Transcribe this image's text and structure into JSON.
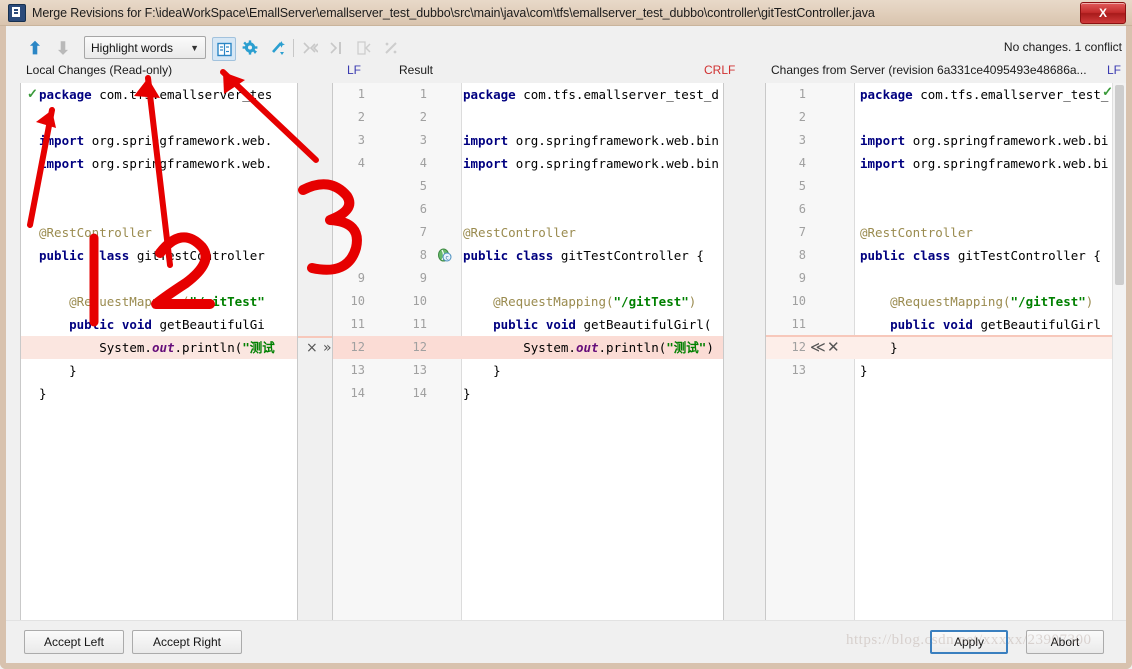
{
  "window": {
    "title": "Merge Revisions for F:\\ideaWorkSpace\\EmallServer\\emallserver_test_dubbo\\src\\main\\java\\com\\tfs\\emallserver_test_dubbo\\controller\\gitTestController.java",
    "close_label": "X",
    "icon": "app-icon"
  },
  "toolbar": {
    "prev_icon": "arrow-up-icon",
    "next_icon": "arrow-down-icon",
    "highlight_mode": "Highlight words",
    "caret": "⌄",
    "icons": [
      "side-by-side-diff-icon",
      "settings-gear-icon",
      "magic-wand-icon",
      "apply-all-left-icon",
      "apply-non-conflicts-icon",
      "apply-left-icon",
      "ignore-icon"
    ],
    "status": "No changes. 1 conflict"
  },
  "panes": {
    "left_title": "Local Changes (Read-only)",
    "left_sep": "LF",
    "result_title": "Result",
    "result_sep": "CRLF",
    "right_title": "Changes from Server (revision 6a331ce4095493e48686a...",
    "right_sep": "LF"
  },
  "left_editor": {
    "lines": [
      "package com.tfs.emallserver_tes",
      "",
      "import org.springframework.web.",
      "import org.springframework.web.",
      "",
      "",
      "@RestController",
      "public class gitTestController",
      "",
      "    @RequestMapping(\"/gitTest\"",
      "    public void getBeautifulGi",
      "        System.out.println(\"测试",
      "    }",
      "}"
    ],
    "check_icon": "green-check-icon"
  },
  "result_editor": {
    "left_numbers": [
      "1",
      "2",
      "3",
      "4",
      "",
      "",
      "",
      "",
      "9",
      "10",
      "11",
      "12",
      "13",
      "14"
    ],
    "right_numbers": [
      "1",
      "2",
      "3",
      "4",
      "5",
      "6",
      "7",
      "8",
      "9",
      "10",
      "11",
      "12",
      "13",
      "14"
    ],
    "lines": [
      "package com.tfs.emallserver_test_d",
      "",
      "import org.springframework.web.bin",
      "import org.springframework.web.bin",
      "",
      "",
      "@RestController",
      "public class gitTestController {",
      "",
      "    @RequestMapping(\"/gitTest\")",
      "    public void getBeautifulGirl(",
      "        System.out.println(\"测试\")",
      "    }",
      "}"
    ],
    "class_icon": "java-class-icon",
    "conflict_row": 12,
    "conflict_actions": [
      "×",
      "»"
    ]
  },
  "right_editor": {
    "numbers": [
      "1",
      "2",
      "3",
      "4",
      "5",
      "6",
      "7",
      "8",
      "9",
      "10",
      "11",
      "12",
      "13"
    ],
    "lines": [
      "package com.tfs.emallserver_test_",
      "",
      "import org.springframework.web.bi",
      "import org.springframework.web.bi",
      "",
      "",
      "@RestController",
      "public class gitTestController {",
      "",
      "    @RequestMapping(\"/gitTest\")",
      "    public void getBeautifulGirl",
      "    }",
      "}"
    ],
    "conflict_row": 12,
    "conflict_actions": [
      "≪",
      "✕"
    ],
    "check_icon": "green-check-icon"
  },
  "buttons": {
    "accept_left": "Accept Left",
    "accept_right": "Accept Right",
    "apply": "Apply",
    "abort": "Abort"
  },
  "annotations": {
    "label_1": "1",
    "label_2": "2",
    "label_3": "3",
    "color": "#e60000"
  },
  "watermark": "https://blog.csdn.net/xxxxx/23907300"
}
